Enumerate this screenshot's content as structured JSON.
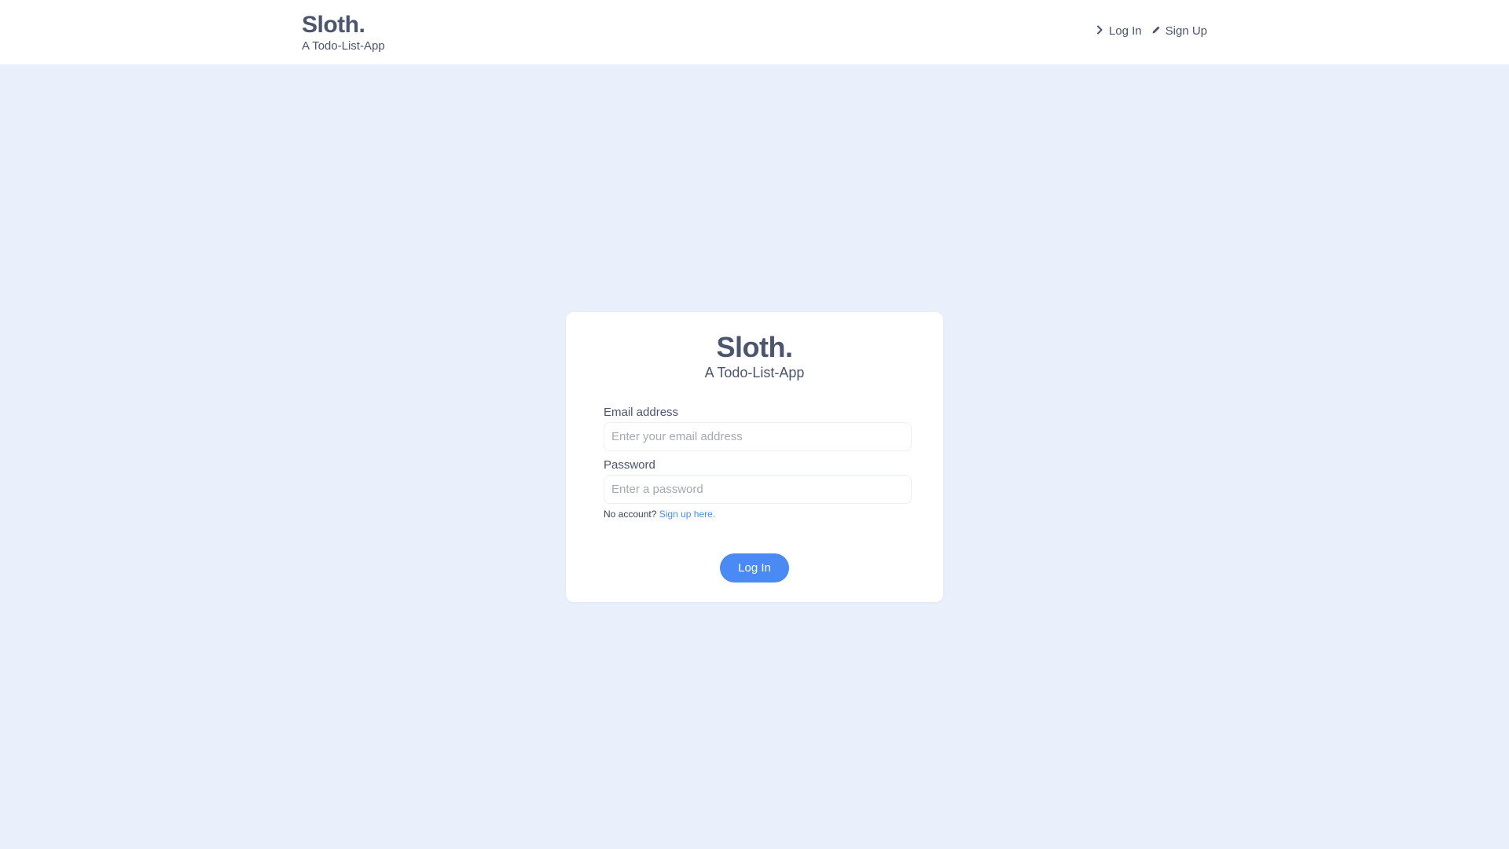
{
  "header": {
    "brand_title": "Sloth.",
    "brand_subtitle": "A Todo-List-App",
    "nav": [
      {
        "label": "Log In",
        "icon": "chevron-right-icon"
      },
      {
        "label": "Sign Up",
        "icon": "pencil-icon"
      }
    ]
  },
  "login_card": {
    "title": "Sloth.",
    "subtitle": "A Todo-List-App",
    "email_label": "Email address",
    "email_placeholder": "Enter your email address",
    "password_label": "Password",
    "password_placeholder": "Enter a password",
    "no_account_text": "No account?",
    "signup_link": "Sign up here.",
    "submit_label": "Log In"
  },
  "colors": {
    "page_background": "#e9f0fc",
    "text": "#4a5570",
    "accent": "#4a8af4"
  }
}
